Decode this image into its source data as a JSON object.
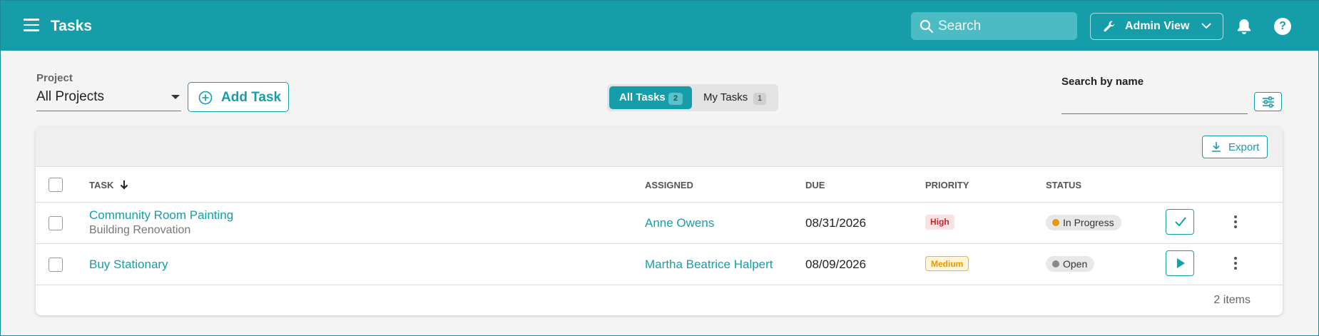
{
  "header": {
    "title": "Tasks",
    "search_placeholder": "Search",
    "view_label": "Admin View"
  },
  "filters": {
    "project_label": "Project",
    "project_value": "All Projects",
    "add_task_label": "Add Task",
    "tabs": [
      {
        "label": "All Tasks",
        "count": "2",
        "active": true
      },
      {
        "label": "My Tasks",
        "count": "1",
        "active": false
      }
    ],
    "search_by_name_label": "Search by name",
    "search_by_name_value": ""
  },
  "table": {
    "export_label": "Export",
    "columns": {
      "task": "TASK",
      "assigned": "ASSIGNED",
      "due": "DUE",
      "priority": "PRIORITY",
      "status": "STATUS"
    },
    "rows": [
      {
        "task": "Community Room Painting",
        "project": "Building Renovation",
        "assigned": "Anne Owens",
        "due": "08/31/2026",
        "priority": "High",
        "status": "In Progress",
        "status_color": "#e69a00",
        "action_icon": "check-icon"
      },
      {
        "task": "Buy Stationary",
        "project": "",
        "assigned": "Martha Beatrice Halpert",
        "due": "08/09/2026",
        "priority": "Medium",
        "status": "Open",
        "status_color": "#888888",
        "action_icon": "play-icon"
      }
    ],
    "item_count": "2 items"
  },
  "colors": {
    "brand": "#159ea9"
  }
}
